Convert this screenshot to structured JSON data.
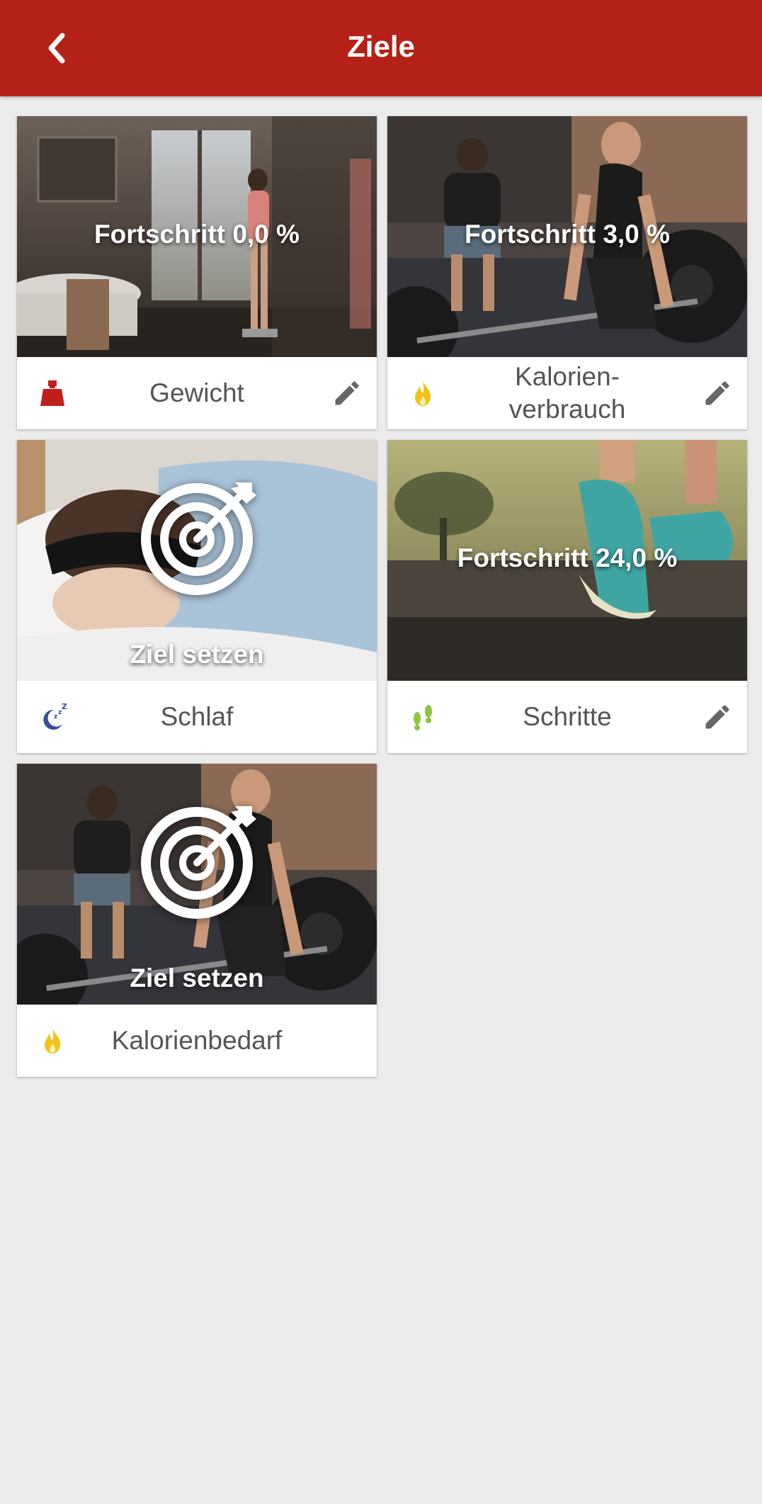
{
  "header": {
    "title": "Ziele",
    "back_icon": "chevron-left-icon"
  },
  "colors": {
    "header_bg": "#b52018",
    "weight_icon": "#c0201b",
    "flame_icon": "#f3c21a",
    "sleep_icon": "#3b4c9b",
    "steps_icon": "#8cc63e",
    "edit_icon": "#666666"
  },
  "cards": [
    {
      "overlay": "Fortschritt 0,0 %",
      "label": "Gewicht",
      "icon": "weight-icon",
      "editable": true,
      "progress_percent": 0.0
    },
    {
      "overlay": "Fortschritt 3,0 %",
      "label": "Kalorien-\nverbrauch",
      "icon": "flame-icon",
      "editable": true,
      "progress_percent": 3.0
    },
    {
      "overlay": "Ziel setzen",
      "label": "Schlaf",
      "icon": "sleep-moon-icon",
      "editable": false,
      "goal_icon": "target-icon"
    },
    {
      "overlay": "Fortschritt 24,0 %",
      "label": "Schritte",
      "icon": "footsteps-icon",
      "editable": true,
      "progress_percent": 24.0
    },
    {
      "overlay": "Ziel setzen",
      "label": "Kalorienbedarf",
      "icon": "flame-icon",
      "editable": false,
      "goal_icon": "target-icon"
    }
  ]
}
